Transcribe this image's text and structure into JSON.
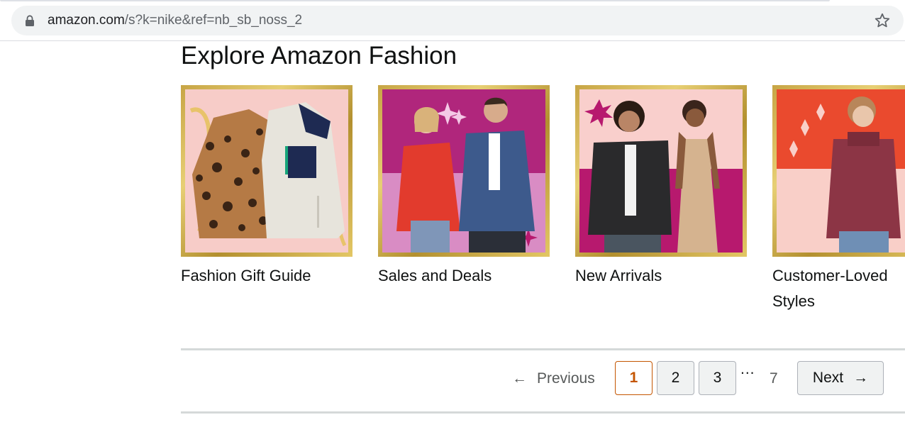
{
  "browser": {
    "url_host": "amazon.com",
    "url_path": "/s?k=nike&ref=nb_sb_noss_2",
    "icons": {
      "lock": "lock-icon",
      "star": "bookmark-star-icon"
    }
  },
  "section": {
    "title": "Explore Amazon Fashion",
    "cards": [
      {
        "label": "Fashion Gift Guide"
      },
      {
        "label": "Sales and Deals"
      },
      {
        "label": "New Arrivals"
      },
      {
        "label": "Customer-Loved Styles"
      }
    ]
  },
  "pagination": {
    "previous_label": "Previous",
    "previous_arrow": "←",
    "pages": [
      "1",
      "2",
      "3"
    ],
    "current_page": "1",
    "ellipsis": "...",
    "last_page": "7",
    "next_label": "Next",
    "next_arrow": "→"
  },
  "colors": {
    "current_page_accent": "#c45500",
    "gold_frame": "#d4b455"
  }
}
